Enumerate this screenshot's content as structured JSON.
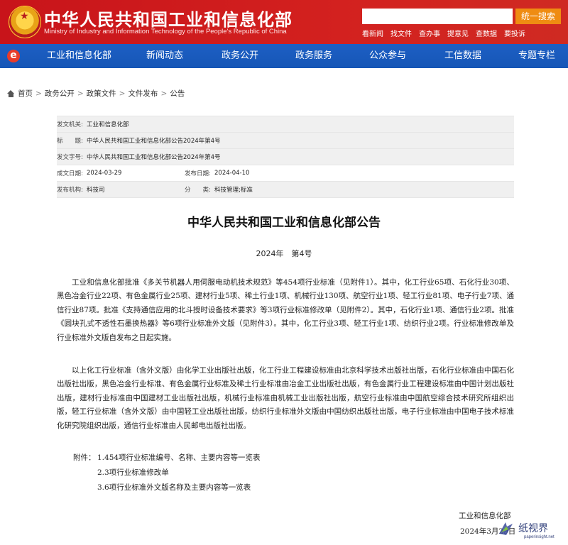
{
  "header": {
    "site_title": "中华人民共和国工业和信息化部",
    "site_subtitle": "Ministry of Industry and Information Technology of the People's Republic of China",
    "search_placeholder": "",
    "search_button": "统一搜索",
    "quick_links": [
      "看新闻",
      "找文件",
      "查办事",
      "提意见",
      "查数据",
      "要投诉"
    ]
  },
  "nav": {
    "logo_glyph": "e",
    "items": [
      "工业和信息化部",
      "新闻动态",
      "政务公开",
      "政务服务",
      "公众参与",
      "工信数据",
      "专题专栏"
    ]
  },
  "breadcrumb": [
    "首页",
    "政务公开",
    "政策文件",
    "文件发布",
    "公告"
  ],
  "meta": {
    "issuer_label": "发文机关:",
    "issuer": "工业和信息化部",
    "title_label": "标　　题:",
    "title": "中华人民共和国工业和信息化部公告2024年第4号",
    "docno_label": "发文字号:",
    "docno": "中华人民共和国工业和信息化部公告2024年第4号",
    "written_label": "成文日期:",
    "written": "2024-03-29",
    "published_label": "发布日期:",
    "published": "2024-04-10",
    "agency_label": "发布机构:",
    "agency": "科技司",
    "category_label": "分　　类:",
    "category": "科技管理;标准"
  },
  "doc": {
    "title": "中华人民共和国工业和信息化部公告",
    "number": "2024年　第4号",
    "para1": "工业和信息化部批准《多关节机器人用伺服电动机技术规范》等454项行业标准（见附件1）。其中，化工行业65项、石化行业30项、黑色冶金行业22项、有色金属行业25项、建材行业5项、稀土行业1项、机械行业130项、航空行业1项、轻工行业81项、电子行业7项、通信行业87项。批准《支持通信应用的北斗授时设备技术要求》等3项行业标准修改单（见附件2）。其中，石化行业1项、通信行业2项。批准《圆块孔式不透性石墨换热器》等6项行业标准外文版（见附件3）。其中，化工行业3项、轻工行业1项、纺织行业2项。行业标准修改单及行业标准外文版自发布之日起实施。",
    "para2": "以上化工行业标准（含外文版）由化学工业出版社出版，化工行业工程建设标准由北京科学技术出版社出版，石化行业标准由中国石化出版社出版，黑色冶金行业标准、有色金属行业标准及稀土行业标准由冶金工业出版社出版，有色金属行业工程建设标准由中国计划出版社出版，建材行业标准由中国建材工业出版社出版，机械行业标准由机械工业出版社出版，航空行业标准由中国航空综合技术研究所组织出版，轻工行业标准（含外文版）由中国轻工业出版社出版，纺织行业标准外文版由中国纺织出版社出版，电子行业标准由中国电子技术标准化研究院组织出版，通信行业标准由人民邮电出版社出版。",
    "attach_label": "附件：",
    "attachments": [
      "1.454项行业标准编号、名称、主要内容等一览表",
      "2.3项行业标准修改单",
      "3.6项行业标准外文版名称及主要内容等一览表"
    ],
    "signer": "工业和信息化部",
    "sign_date": "2024年3月29日"
  },
  "watermark": {
    "text": "纸视界",
    "url": "paperinsight.net"
  }
}
